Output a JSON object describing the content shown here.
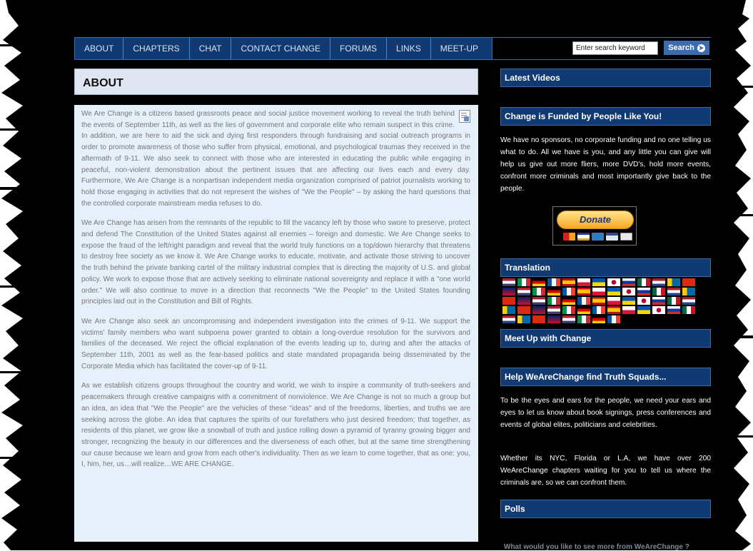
{
  "nav": {
    "items": [
      "ABOUT",
      "CHAPTERS",
      "CHAT",
      "CONTACT CHANGE",
      "FORUMS",
      "LINKS",
      "MEET-UP"
    ]
  },
  "search": {
    "placeholder": "Enter search keyword",
    "button_label": "Search"
  },
  "main": {
    "title": "ABOUT",
    "paragraphs": [
      "We Are Change is a citizens based grassroots peace and social justice movement working to reveal the truth behind the events of September 11th, as well as the lies of government and corporate elite who remain suspect in this crime. In addition, we are here to aid the sick and dying first responders through fundraising and social outreach programs in order to promote awareness of those who suffer from physical, emotional, and psychological traumas they received in the aftermath of 9-11. We also seek to connect with those who are interested in educating the public while engaging in peaceful, non-violent demonstration about the pertinent issues that are affecting our lives each and every day. Furthermore, We Are Change is a nonpartisan independent media organization comprised of patriot journalists working to hold those engaging in activities that do not represent the wishes of \"We the People\" – by asking the hard questions that the controlled corporate mainstream media refuses to do.",
      "We Are Change has arisen from the remnants of the republic to fill the vacancy left by those who swore to preserve, protect and defend The Constitution of the United States against all enemies – foreign and domestic. We Are Change seeks to expose the fraud of the left/right paradigm and reveal that the world truly functions on a top/down hierarchy that threatens to destroy free society as we know it. We Are Change works to educate, motivate, and activate those striving to uncover the truth behind the private banking cartel of the military industrial complex that is directing the majority of U.S. and global policy. We work to expose those that are actively seeking to eliminate national sovereignty and replace it with a \"one world order.\" We will also continue to move in a direction that reconnects \"We the People\" to the United States founding principles laid out in the Constitution and Bill of Rights.",
      "We Are Change also seek an uncompromising and independent investigation into the crimes of 9-11. We support the victims' family members who want subpoena power granted to obtain a long-overdue resolution for the survivors and families of the deceased. We reject the official explanation of the events leading up to, during and after the attacks of September 11th, 2001 as well as the fear-based politics and state mandated propaganda being disseminated by the Corporate Media which has facilitated the cover-up of 9-11.",
      "As we establish citizens groups throughout the country and world, we wish to inspire a community of truth-seekers and peacemakers through creative campaigns with a commitment of nonviolence. We Are Change is not so much a group but an idea, an idea that \"We the People\" are the vehicles of these \"ideas\" and of the freedoms, liberties, and truths we are seeking across the globe. An idea that captures the spirits of our forefathers who just desired freedom; that together, as residents of this planet, we grow like a snowball of truth and justice rolling down a pyramid of tyranny growing bigger and stronger, recognizing the beauty in our differences and the diverseness of each other, but at the same time strengthening our cause because we learn and grow from each other's individuality. Then as we learn to come together, that as one: you, I, him, her, us…will realize…WE ARE CHANGE."
    ]
  },
  "sidebar": {
    "latest_videos": "Latest Videos",
    "funded_title": "Change is Funded by People Like You!",
    "funded_text": "We have no sponsors, no corporate funding and no one telling us what to do. All we have is you, and any little you can give will help us give out more fliers, more DVD's, hold more events, confront more criminals and most importantly give back to the people.",
    "donate_label": "Donate",
    "translation_title": "Translation",
    "meetup_title": "Meet Up with Change",
    "squads_title": "Help WeAreChange find Truth Squads...",
    "squads_text_1": "To be the eyes and ears for the people, we need your ears and eyes to let us know about book signings, press conferences and events of global elites, politicians and celebrities.",
    "squads_text_2": "Whether its NYC, Florida or L.A, we have over 200 WeAreChange chapters waiting for you to tell us where the criminals are, so we can confront them.",
    "polls_title": "Polls",
    "polls_question": "What would you like to see more from WeAreChange ?"
  },
  "colors": {
    "nav_bg": "#123a72",
    "content_bg": "#e6f0fa",
    "page_bg": "#000000"
  },
  "icons": {
    "search_button": "arrow-right-circle-icon",
    "content_corner": "document-icon",
    "payment_cards": [
      "mastercard-icon",
      "visa-icon",
      "amex-icon",
      "paypal-icon",
      "bank-icon"
    ]
  }
}
